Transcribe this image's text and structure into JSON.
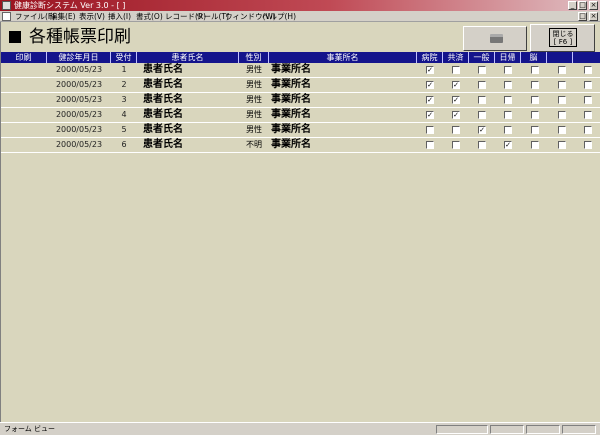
{
  "titlebar": {
    "title": "健康診断システム Ver 3.0 - [ ]"
  },
  "menubar": {
    "items": [
      "ファイル(F)",
      "編集(E)",
      "表示(V)",
      "挿入(I)",
      "書式(O)",
      "レコード(R)",
      "ツール(T)",
      "ウィンドウ(W)",
      "ヘルプ(H)"
    ]
  },
  "form": {
    "title": "各種帳票印刷",
    "close_button": {
      "line1": "閉じる",
      "line2": "[ F6 ]"
    }
  },
  "grid": {
    "headers": [
      "印刷",
      "健診年月日",
      "受付",
      "患者氏名",
      "性別",
      "事業所名",
      "病院",
      "共済",
      "一般",
      "日帰",
      "脳",
      "",
      ""
    ],
    "rows": [
      {
        "date": "2000/05/23",
        "num": "1",
        "name": "患者氏名",
        "sex": "男性",
        "office": "事業所名",
        "checks": [
          true,
          false,
          false,
          false,
          false,
          false,
          false
        ]
      },
      {
        "date": "2000/05/23",
        "num": "2",
        "name": "患者氏名",
        "sex": "男性",
        "office": "事業所名",
        "checks": [
          true,
          true,
          false,
          false,
          false,
          false,
          false
        ]
      },
      {
        "date": "2000/05/23",
        "num": "3",
        "name": "患者氏名",
        "sex": "男性",
        "office": "事業所名",
        "checks": [
          true,
          true,
          false,
          false,
          false,
          false,
          false
        ]
      },
      {
        "date": "2000/05/23",
        "num": "4",
        "name": "患者氏名",
        "sex": "男性",
        "office": "事業所名",
        "checks": [
          true,
          true,
          false,
          false,
          false,
          false,
          false
        ]
      },
      {
        "date": "2000/05/23",
        "num": "5",
        "name": "患者氏名",
        "sex": "男性",
        "office": "事業所名",
        "checks": [
          false,
          false,
          true,
          false,
          false,
          false,
          false
        ]
      },
      {
        "date": "2000/05/23",
        "num": "6",
        "name": "患者氏名",
        "sex": "不明",
        "office": "事業所名",
        "checks": [
          false,
          false,
          false,
          true,
          false,
          false,
          false
        ]
      }
    ]
  },
  "statusbar": {
    "text": "フォーム ビュー"
  },
  "colors": {
    "header_bg": "#14148c",
    "form_bg": "#d9d6bd",
    "titlebar": "#9a1420"
  }
}
